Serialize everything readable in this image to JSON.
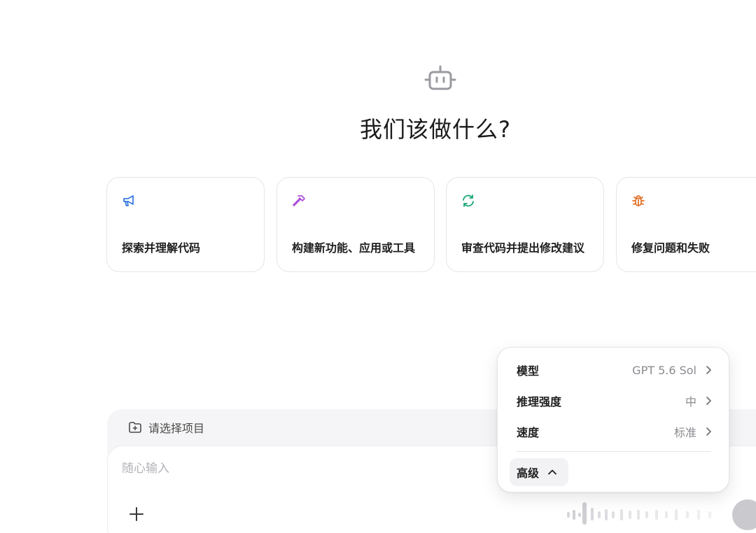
{
  "hero": {
    "icon": "robot-icon",
    "title": "我们该做什么?"
  },
  "cards": [
    {
      "icon": "megaphone-icon",
      "icon_color": "#3a7be0",
      "label": "探索并理解代码"
    },
    {
      "icon": "hammer-icon",
      "icon_color": "#b04fd6",
      "label": "构建新功能、应用或工具"
    },
    {
      "icon": "refresh-icon",
      "icon_color": "#1eaa78",
      "label": "审查代码并提出修改建议"
    },
    {
      "icon": "bug-icon",
      "icon_color": "#e2742c",
      "label": "修复问题和失败"
    }
  ],
  "composer": {
    "project_label": "请选择项目",
    "project_icon": "folder-plus-icon",
    "input_placeholder": "随心输入",
    "add_icon": "plus-icon"
  },
  "popover": {
    "rows": [
      {
        "label": "模型",
        "value": "GPT 5.6 Sol"
      },
      {
        "label": "推理强度",
        "value": "中"
      },
      {
        "label": "速度",
        "value": "标准"
      }
    ],
    "advanced_label": "高级"
  }
}
